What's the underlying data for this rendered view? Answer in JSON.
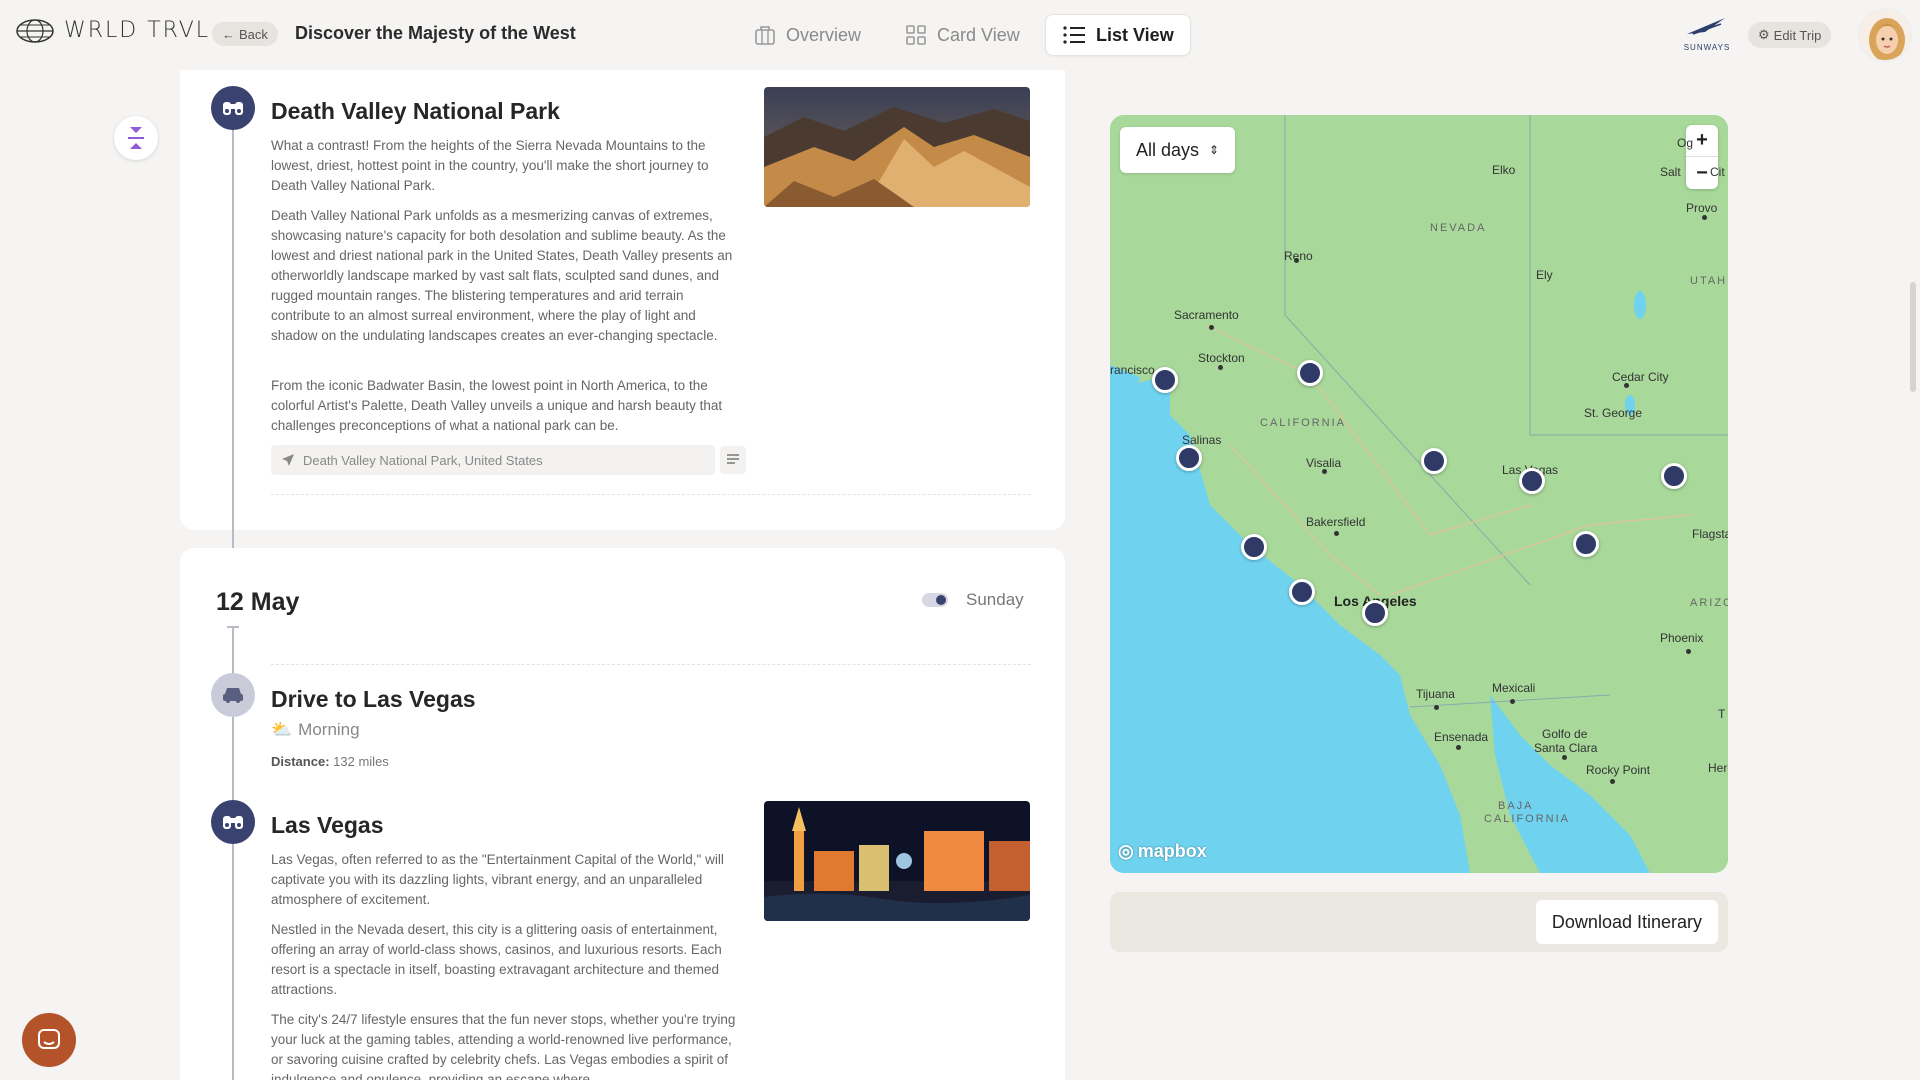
{
  "header": {
    "logo_text": "WRLD TRVL",
    "back_label": "Back",
    "trip_title": "Discover the Majesty of the West",
    "tabs": [
      {
        "label": "Overview",
        "icon": "bag-icon"
      },
      {
        "label": "Card View",
        "icon": "grid-icon"
      },
      {
        "label": "List View",
        "icon": "list-icon",
        "active": true
      }
    ],
    "partner_logo": "SUNWAYS",
    "edit_trip_label": "Edit Trip"
  },
  "itinerary": {
    "activities": [
      {
        "title": "Death Valley National Park",
        "icon": "binoculars-icon",
        "paragraphs": [
          "What a contrast! From the heights of the Sierra Nevada Mountains to the lowest, driest, hottest point in the country, you'll make the short journey to Death Valley National Park.",
          "Death Valley National Park unfolds as a mesmerizing canvas of extremes, showcasing nature's capacity for both desolation and sublime beauty. As the lowest and driest national park in the United States, Death Valley presents an otherworldly landscape marked by vast salt flats, sculpted sand dunes, and rugged mountain ranges. The blistering temperatures and arid terrain contribute to an almost surreal environment, where the play of light and shadow on the undulating landscapes creates an ever-changing spectacle.",
          "From the iconic Badwater Basin, the lowest point in North America, to the colorful Artist's Palette, Death Valley unveils a unique and harsh beauty that challenges preconceptions of what a national park can be."
        ],
        "location": "Death Valley National Park, United States"
      }
    ],
    "day2": {
      "date": "12 May",
      "weekday": "Sunday",
      "drive": {
        "title": "Drive to Las Vegas",
        "time_of_day": "Morning",
        "distance_label": "Distance:",
        "distance_value": "132 miles"
      },
      "activity": {
        "title": "Las Vegas",
        "paragraphs": [
          "Las Vegas, often referred to as the \"Entertainment Capital of the World,\" will captivate you with its dazzling lights, vibrant energy, and an unparalleled atmosphere of excitement.",
          "Nestled in the Nevada desert, this city is a glittering oasis of entertainment, offering an array of world-class shows, casinos, and luxurious resorts. Each resort is a spectacle in itself, boasting extravagant architecture and themed attractions.",
          "The city's 24/7 lifestyle ensures that the fun never stops, whether you're trying your luck at the gaming tables, attending a world-renowned live performance, or savoring cuisine crafted by celebrity chefs. Las Vegas embodies a spirit of indulgence and opulence, providing an escape where"
        ]
      }
    }
  },
  "map": {
    "filter_label": "All days",
    "zoom_in": "+",
    "zoom_out": "−",
    "attribution": "mapbox",
    "labels": {
      "nevada": "NEVADA",
      "utah": "UTAH",
      "california": "CALIFORNIA",
      "arizona": "ARIZO",
      "baja": "BAJA",
      "baja2": "CALIFORNIA",
      "elko": "Elko",
      "reno": "Reno",
      "ely": "Ely",
      "provo": "Provo",
      "salt": "Salt",
      "ogden": "Og",
      "city": "Cit",
      "sacramento": "Sacramento",
      "stockton": "Stockton",
      "sanfran": "rancisco",
      "salinas": "Salinas",
      "visalia": "Visalia",
      "bakersfield": "Bakersfield",
      "lasvegas": "Las Vegas",
      "cedarcity": "Cedar City",
      "stgeorge": "St. George",
      "flagstaff": "Flagstaf",
      "losangeles": "Los Angeles",
      "phoenix": "Phoenix",
      "tijuana": "Tijuana",
      "mexicali": "Mexicali",
      "ensenada": "Ensenada",
      "golfo1": "Golfo de",
      "golfo2": "Santa Clara",
      "rockypoint": "Rocky Point",
      "hero": "Hero",
      "t": "T"
    }
  },
  "download_label": "Download Itinerary",
  "colors": {
    "accent": "#3a4270",
    "background": "#f5f4f2",
    "land": "#a8d89a",
    "water": "#6fd3f0",
    "chat": "#b4532a"
  }
}
